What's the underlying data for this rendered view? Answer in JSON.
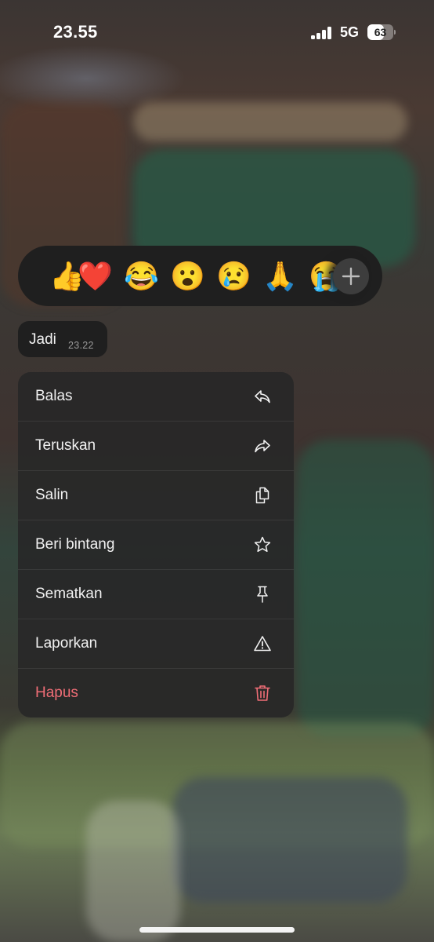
{
  "status_bar": {
    "time": "23.55",
    "network": "5G",
    "battery": "63",
    "battery_fraction": 0.63,
    "signal_bars": 4
  },
  "reactions": [
    {
      "emoji": "👍",
      "name": "thumbs-up"
    },
    {
      "emoji": "❤️",
      "name": "red-heart"
    },
    {
      "emoji": "😂",
      "name": "tears-of-joy"
    },
    {
      "emoji": "😮",
      "name": "surprised"
    },
    {
      "emoji": "😢",
      "name": "crying"
    },
    {
      "emoji": "🙏",
      "name": "folded-hands"
    },
    {
      "emoji": "😭",
      "name": "loudly-crying"
    }
  ],
  "message": {
    "text": "Jadi",
    "time": "23.22"
  },
  "menu": {
    "items": [
      {
        "label": "Balas",
        "icon": "reply-icon"
      },
      {
        "label": "Teruskan",
        "icon": "forward-icon"
      },
      {
        "label": "Salin",
        "icon": "copy-icon"
      },
      {
        "label": "Beri bintang",
        "icon": "star-icon"
      },
      {
        "label": "Sematkan",
        "icon": "pin-icon"
      },
      {
        "label": "Laporkan",
        "icon": "warning-icon"
      },
      {
        "label": "Hapus",
        "icon": "trash-icon",
        "destructive": true
      }
    ]
  },
  "colors": {
    "destructive": "#ef6d76",
    "menu_background": "#282828",
    "reaction_bar_background": "#1f1f1f"
  }
}
